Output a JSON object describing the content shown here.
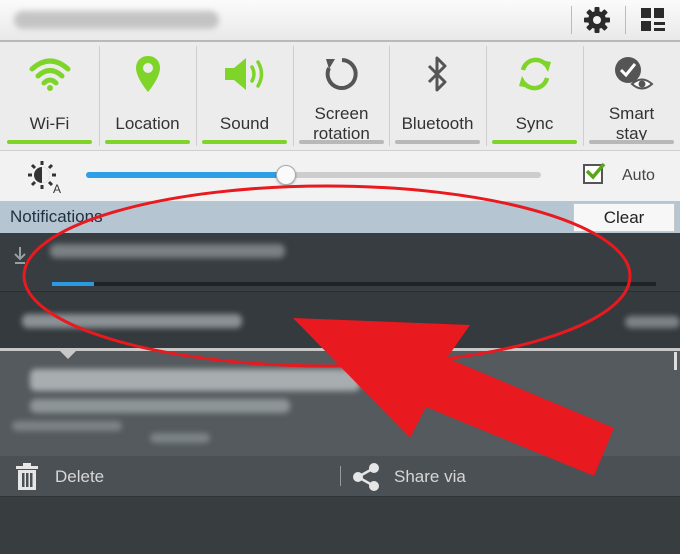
{
  "quick_settings": {
    "toggles": [
      {
        "label": "Wi-Fi",
        "icon": "wifi-icon",
        "state": "on"
      },
      {
        "label": "Location",
        "icon": "location-icon",
        "state": "on"
      },
      {
        "label": "Sound",
        "icon": "sound-icon",
        "state": "on"
      },
      {
        "label": "Screen\nrotation",
        "icon": "screen-rotation-icon",
        "state": "off"
      },
      {
        "label": "Bluetooth",
        "icon": "bluetooth-icon",
        "state": "off"
      },
      {
        "label": "Sync",
        "icon": "sync-icon",
        "state": "on"
      },
      {
        "label": "Smart\nstay",
        "icon": "smart-stay-icon",
        "state": "off"
      }
    ]
  },
  "brightness": {
    "level": 0.44,
    "auto_label": "Auto",
    "auto_checked": true
  },
  "notifications": {
    "header": "Notifications",
    "clear_label": "Clear",
    "download_progress": 0.07
  },
  "actions": {
    "delete_label": "Delete",
    "share_label": "Share via"
  },
  "colors": {
    "accent_on": "#7fd42a",
    "accent_off": "#b8b8b8",
    "highlight": "#e8191f",
    "slider": "#2c9fe6"
  }
}
